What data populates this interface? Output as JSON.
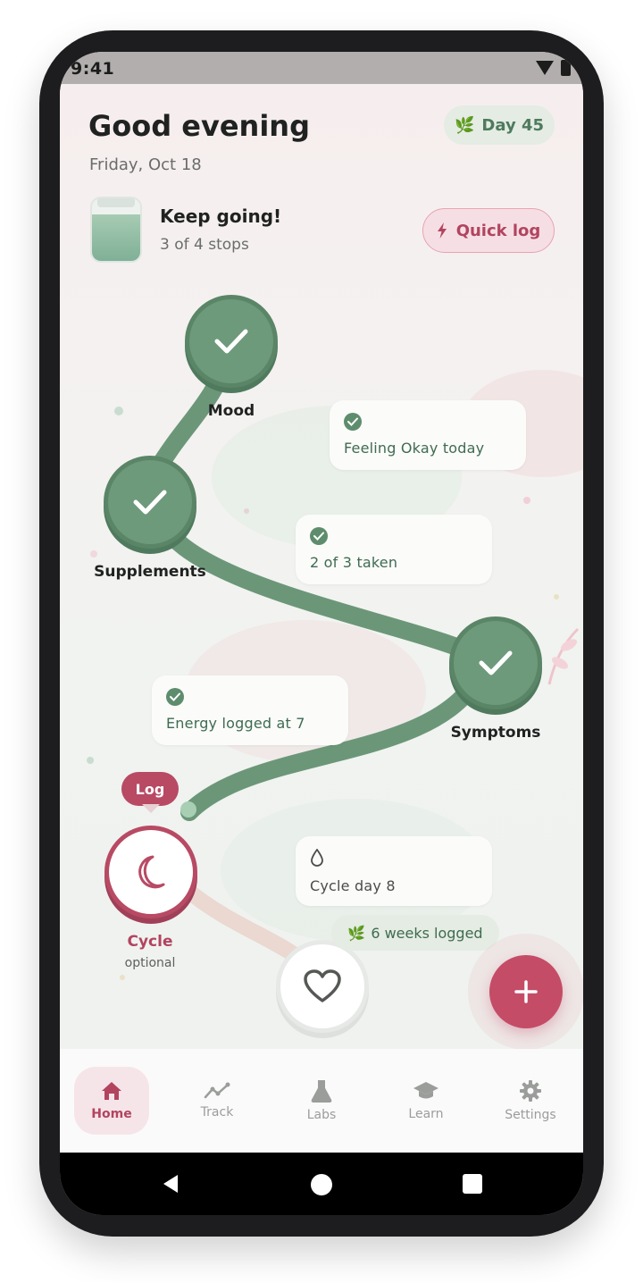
{
  "status_bar": {
    "time": "9:41"
  },
  "header": {
    "greeting": "Good evening",
    "date": "Friday, Oct 18",
    "day_badge": "Day 45"
  },
  "progress": {
    "title": "Keep going!",
    "subtitle": "3 of 4 stops",
    "completed_stops": 3,
    "total_stops": 4,
    "quick_log_label": "Quick log"
  },
  "path": {
    "nodes": [
      {
        "label": "Mood",
        "status": "done"
      },
      {
        "label": "Supplements",
        "status": "done"
      },
      {
        "label": "Symptoms",
        "status": "done"
      },
      {
        "label": "Cycle",
        "sublabel": "optional",
        "status": "current",
        "badge": "Log"
      },
      {
        "label": "",
        "status": "locked"
      }
    ],
    "cards": [
      {
        "text": "Feeling Okay today",
        "icon": "check-icon"
      },
      {
        "text": "2 of 3 taken",
        "icon": "check-icon"
      },
      {
        "text": "Energy logged at 7",
        "icon": "check-icon"
      },
      {
        "text": "Cycle day 8",
        "icon": "droplet-icon"
      }
    ],
    "weeks_badge": "6 weeks logged"
  },
  "bottom_nav": {
    "items": [
      {
        "label": "Home",
        "icon": "home-icon",
        "active": true
      },
      {
        "label": "Track",
        "icon": "trend-icon",
        "active": false
      },
      {
        "label": "Labs",
        "icon": "flask-icon",
        "active": false
      },
      {
        "label": "Learn",
        "icon": "graduation-cap-icon",
        "active": false
      },
      {
        "label": "Settings",
        "icon": "gear-icon",
        "active": false
      }
    ]
  },
  "colors": {
    "accent_green": "#6d9a7b",
    "accent_rose": "#b84a64",
    "fab": "#c54c66"
  }
}
